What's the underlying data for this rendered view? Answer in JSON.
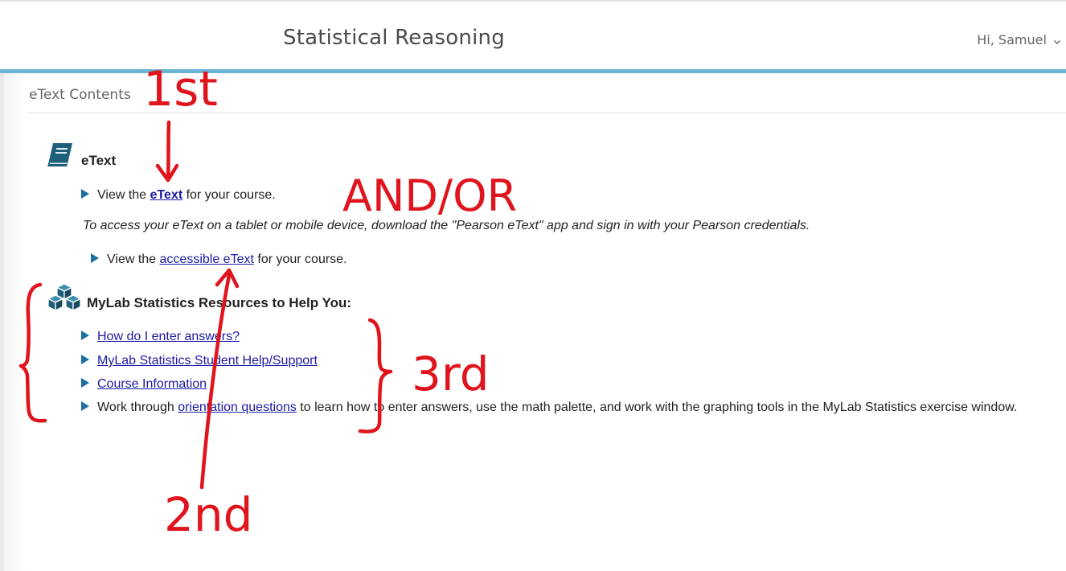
{
  "header": {
    "course_title": "Statistical Reasoning",
    "user_greeting": "Hi, Samuel"
  },
  "section": {
    "title": "eText Contents"
  },
  "etext_block": {
    "icon": "book-icon",
    "title": "eText",
    "view_prefix": "View the ",
    "view_link": "eText",
    "view_suffix": " for your course.",
    "mobile_note": "To access your eText on a tablet or mobile device, download the \"Pearson eText\" app and sign in with your Pearson credentials.",
    "accessible_prefix": "View the ",
    "accessible_link": "accessible eText",
    "accessible_suffix": " for your course."
  },
  "resources_block": {
    "icon": "cubes-icon",
    "title": "MyLab Statistics Resources to Help You:",
    "links": [
      "How do I enter answers?",
      "MyLab Statistics Student Help/Support",
      "Course Information"
    ],
    "orientation_prefix": "Work through ",
    "orientation_link": "orientation questions",
    "orientation_suffix": " to learn how to enter answers, use the math palette, and work with the graphing tools in the MyLab Statistics exercise window."
  },
  "annotations": {
    "first": "1st",
    "and_or": "AND/OR",
    "second": "2nd",
    "third": "3rd",
    "color": "#e0141c"
  },
  "colors": {
    "accent_bar": "#6cb4d4",
    "link": "#1a1aa6",
    "bullet": "#1b6fa0",
    "icon": "#1e5f7c"
  }
}
